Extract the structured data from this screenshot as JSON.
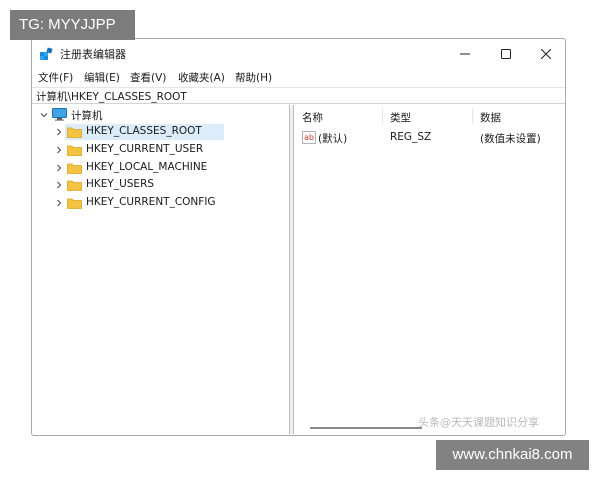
{
  "overlays": {
    "top_left": "TG: MYYJJPP",
    "bottom_right": "www.chnkai8.com"
  },
  "window": {
    "title": "注册表编辑器",
    "controls": {
      "minimize": "minimize",
      "maximize": "maximize",
      "close": "close"
    }
  },
  "menu": {
    "items": [
      {
        "label": "文件(F)"
      },
      {
        "label": "编辑(E)"
      },
      {
        "label": "查看(V)"
      },
      {
        "label": "收藏夹(A)"
      },
      {
        "label": "帮助(H)"
      }
    ]
  },
  "address": {
    "path": "计算机\\HKEY_CLASSES_ROOT"
  },
  "tree": {
    "root": {
      "label": "计算机",
      "icon": "computer-icon",
      "expanded": true
    },
    "children": [
      {
        "label": "HKEY_CLASSES_ROOT",
        "selected": true
      },
      {
        "label": "HKEY_CURRENT_USER",
        "selected": false
      },
      {
        "label": "HKEY_LOCAL_MACHINE",
        "selected": false
      },
      {
        "label": "HKEY_USERS",
        "selected": false
      },
      {
        "label": "HKEY_CURRENT_CONFIG",
        "selected": false
      }
    ]
  },
  "values_table": {
    "columns": [
      "名称",
      "类型",
      "数据"
    ],
    "rows": [
      {
        "name": "(默认)",
        "type": "REG_SZ",
        "data": "(数值未设置)",
        "icon": "string-value-icon"
      }
    ]
  },
  "watermark": "头条@天天课题知识分享",
  "colors": {
    "selection": "#dcecfb",
    "folder": "#f5c342",
    "accent": "#1e88d8"
  }
}
